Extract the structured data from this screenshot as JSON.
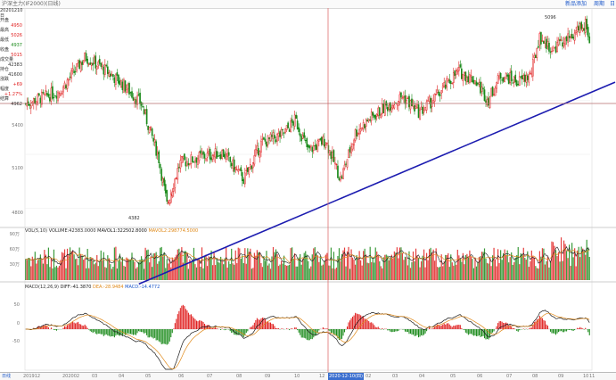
{
  "window": {
    "title": "沪深主力(IF2000)(日线)",
    "toolbar": [
      "新品添加",
      "周期",
      "日"
    ]
  },
  "info_panel": {
    "date": "20201210",
    "fields": [
      {
        "label": "日",
        "value": "",
        "color": "#333333"
      },
      {
        "label": "开盘",
        "value": "4950",
        "color": "#e02020"
      },
      {
        "label": "最高",
        "value": "5026",
        "color": "#e02020"
      },
      {
        "label": "最低",
        "value": "4937",
        "color": "#1a8a1a"
      },
      {
        "label": "收盘",
        "value": "5015",
        "color": "#e02020"
      },
      {
        "label": "成交量",
        "value": "42383",
        "color": "#333333"
      },
      {
        "label": "持仓",
        "value": "41600",
        "color": "#333333"
      },
      {
        "label": "涨跌",
        "value": "+69",
        "color": "#e02020"
      },
      {
        "label": "幅度",
        "value": "+1.27%",
        "color": "#e02020"
      },
      {
        "label": "结算",
        "value": "4962",
        "color": "#333333"
      }
    ]
  },
  "price_axis": [
    "5400",
    "5100",
    "4800"
  ],
  "annotations": {
    "high": "5096",
    "low": "4382"
  },
  "volume_panel": {
    "label": "VOL(5,10)",
    "items": [
      {
        "text": "VOLUME:42383.0000",
        "color": "#333333"
      },
      {
        "text": "MAVOL1:322502.8000",
        "color": "#1a1a1a"
      },
      {
        "text": "MAVOL2:298774.5000",
        "color": "#e08a1a"
      }
    ],
    "axis": [
      "90万",
      "60万",
      "30万"
    ]
  },
  "macd_panel": {
    "label": "MACD(12,26,9)",
    "items": [
      {
        "text": "DIFF:-41.3870",
        "color": "#1a1a1a"
      },
      {
        "text": "DEA:-28.9484",
        "color": "#e08a1a"
      },
      {
        "text": "MACD:-14.4772",
        "color": "#1a56c9"
      }
    ],
    "axis": [
      "50",
      "0",
      "-50"
    ]
  },
  "x_axis": {
    "corner": "日线",
    "labels": [
      "201912",
      "202002",
      "03",
      "04",
      "05",
      "06",
      "07",
      "08",
      "09",
      "10",
      "12",
      "2020-12-10(四)",
      "02",
      "03",
      "04",
      "05",
      "06",
      "07",
      "08",
      "09",
      "10",
      "11"
    ],
    "cursor_label": "2020-12-10(四)"
  },
  "chart_data": {
    "type": "candlestick",
    "series": [
      {
        "name": "price",
        "points": [
          [
            0,
            5380
          ],
          [
            40,
            5450
          ],
          [
            70,
            5640
          ],
          [
            95,
            5560
          ],
          [
            115,
            5480
          ],
          [
            135,
            5380
          ],
          [
            155,
            5090
          ],
          [
            165,
            4820
          ],
          [
            180,
            5050
          ],
          [
            200,
            5080
          ],
          [
            230,
            5110
          ],
          [
            255,
            4960
          ],
          [
            275,
            5160
          ],
          [
            300,
            5210
          ],
          [
            315,
            5290
          ],
          [
            330,
            5120
          ],
          [
            350,
            5180
          ],
          [
            368,
            4960
          ],
          [
            385,
            5220
          ],
          [
            400,
            5290
          ],
          [
            420,
            5360
          ],
          [
            440,
            5420
          ],
          [
            460,
            5330
          ],
          [
            480,
            5420
          ],
          [
            505,
            5560
          ],
          [
            525,
            5510
          ],
          [
            540,
            5400
          ],
          [
            555,
            5540
          ],
          [
            575,
            5500
          ],
          [
            590,
            5540
          ],
          [
            600,
            5750
          ],
          [
            615,
            5680
          ],
          [
            640,
            5760
          ],
          [
            655,
            5820
          ],
          [
            660,
            5680
          ]
        ]
      },
      {
        "name": "trendline",
        "points": [
          [
            133,
            4382
          ],
          [
            668,
            5460
          ]
        ]
      }
    ]
  },
  "colors": {
    "up": "#e02020",
    "down": "#1a8a1a",
    "trend": "#1c1cb0",
    "cursor": "#e07070"
  }
}
